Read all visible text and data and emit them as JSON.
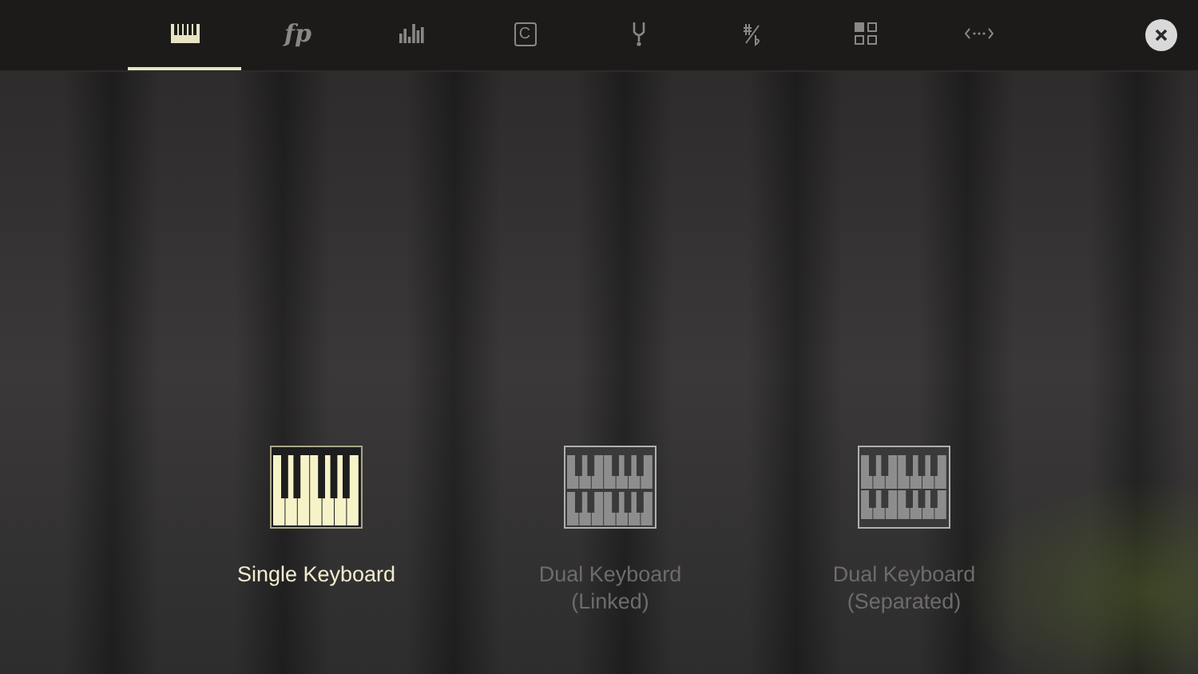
{
  "toolbar": {
    "tabs": [
      {
        "kind": "keyboard",
        "selected": true
      },
      {
        "kind": "dynamics",
        "label": "fp",
        "selected": false
      },
      {
        "kind": "equalizer",
        "selected": false
      },
      {
        "kind": "key",
        "label": "C",
        "selected": false
      },
      {
        "kind": "tuning",
        "selected": false
      },
      {
        "kind": "transpose",
        "selected": false
      },
      {
        "kind": "grid",
        "selected": false
      },
      {
        "kind": "width",
        "selected": false
      }
    ]
  },
  "modes": [
    {
      "kind": "single",
      "lines": [
        "Single Keyboard"
      ],
      "selected": true
    },
    {
      "kind": "linked",
      "lines": [
        "Dual Keyboard",
        "(Linked)"
      ],
      "selected": false
    },
    {
      "kind": "separated",
      "lines": [
        "Dual Keyboard",
        "(Separated)"
      ],
      "selected": false
    }
  ]
}
